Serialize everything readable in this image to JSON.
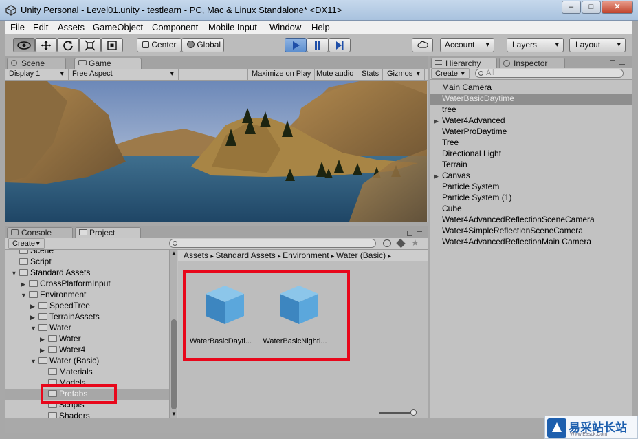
{
  "window": {
    "title": "Unity Personal - Level01.unity - testlearn - PC, Mac & Linux Standalone* <DX11>",
    "minimize_glyph": "–",
    "maximize_glyph": "□",
    "close_glyph": "✕"
  },
  "menu": [
    "File",
    "Edit",
    "Assets",
    "GameObject",
    "Component",
    "Mobile Input",
    "Window",
    "Help"
  ],
  "toolbar": {
    "pivot_label": "Center",
    "space_label": "Global",
    "account_label": "Account",
    "layers_label": "Layers",
    "layout_label": "Layout"
  },
  "top_panel": {
    "tabs": [
      "Scene",
      "Game"
    ],
    "display": "Display 1",
    "aspect": "Free Aspect",
    "options": [
      "Maximize on Play",
      "Mute audio",
      "Stats",
      "Gizmos"
    ]
  },
  "hierarchy": {
    "tabs": [
      "Hierarchy",
      "Inspector"
    ],
    "create_label": "Create",
    "search_placeholder": "All",
    "items": [
      {
        "label": "Main Camera",
        "selected": false,
        "foldable": false
      },
      {
        "label": "WaterBasicDaytime",
        "selected": true,
        "foldable": false
      },
      {
        "label": "tree",
        "selected": false,
        "foldable": false
      },
      {
        "label": "Water4Advanced",
        "selected": false,
        "foldable": true
      },
      {
        "label": "WaterProDaytime",
        "selected": false,
        "foldable": false
      },
      {
        "label": "Tree",
        "selected": false,
        "foldable": false
      },
      {
        "label": "Directional Light",
        "selected": false,
        "foldable": false
      },
      {
        "label": "Terrain",
        "selected": false,
        "foldable": false
      },
      {
        "label": "Canvas",
        "selected": false,
        "foldable": true
      },
      {
        "label": "Particle System",
        "selected": false,
        "foldable": false
      },
      {
        "label": "Particle System (1)",
        "selected": false,
        "foldable": false
      },
      {
        "label": "Cube",
        "selected": false,
        "foldable": false
      },
      {
        "label": "Water4AdvancedReflectionSceneCamera",
        "selected": false,
        "foldable": false
      },
      {
        "label": "Water4SimpleReflectionSceneCamera",
        "selected": false,
        "foldable": false
      },
      {
        "label": "Water4AdvancedReflectionMain Camera",
        "selected": false,
        "foldable": false
      }
    ]
  },
  "project": {
    "tabs": [
      "Console",
      "Project"
    ],
    "create_label": "Create",
    "tree": [
      {
        "label": "Scene",
        "depth": 1,
        "arrow": ""
      },
      {
        "label": "Script",
        "depth": 1,
        "arrow": ""
      },
      {
        "label": "Standard Assets",
        "depth": 1,
        "arrow": "▼"
      },
      {
        "label": "CrossPlatformInput",
        "depth": 2,
        "arrow": "▶"
      },
      {
        "label": "Environment",
        "depth": 2,
        "arrow": "▼"
      },
      {
        "label": "SpeedTree",
        "depth": 3,
        "arrow": "▶"
      },
      {
        "label": "TerrainAssets",
        "depth": 3,
        "arrow": "▶"
      },
      {
        "label": "Water",
        "depth": 3,
        "arrow": "▼"
      },
      {
        "label": "Water",
        "depth": 4,
        "arrow": "▶"
      },
      {
        "label": "Water4",
        "depth": 4,
        "arrow": "▶"
      },
      {
        "label": "Water (Basic)",
        "depth": 3,
        "arrow": "▼"
      },
      {
        "label": "Materials",
        "depth": 4,
        "arrow": ""
      },
      {
        "label": "Models",
        "depth": 4,
        "arrow": ""
      },
      {
        "label": "Prefabs",
        "depth": 4,
        "arrow": ""
      },
      {
        "label": "Scripts",
        "depth": 4,
        "arrow": ""
      },
      {
        "label": "Shaders",
        "depth": 4,
        "arrow": ""
      }
    ],
    "selected_folder": "Prefabs",
    "breadcrumb": [
      "Assets",
      "Standard Assets",
      "Environment",
      "Water (Basic)"
    ],
    "assets": [
      "WaterBasicDayti...",
      "WaterBasicNighti..."
    ]
  },
  "watermark": {
    "text": "易采站长站",
    "sub": "Www.Easck.Com"
  }
}
